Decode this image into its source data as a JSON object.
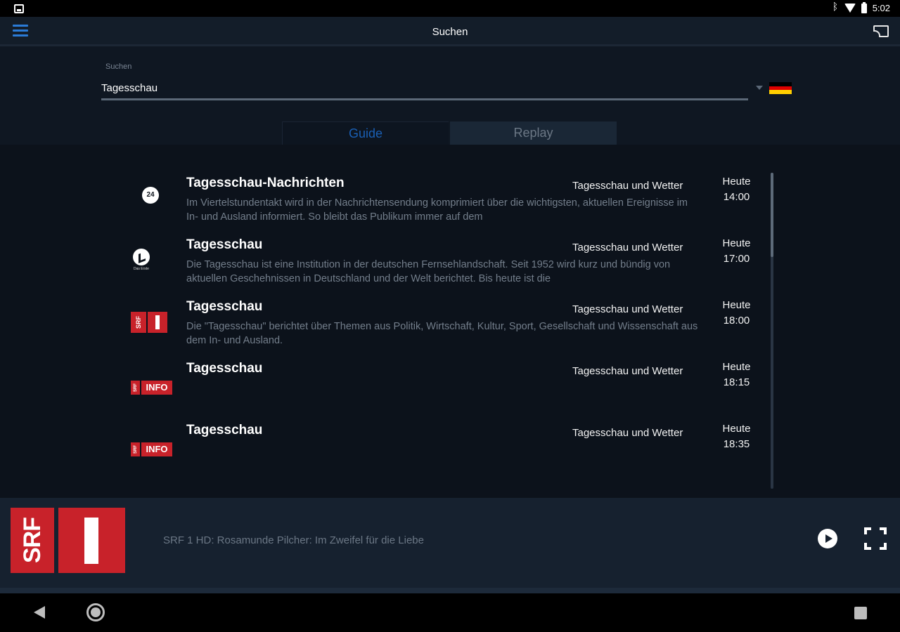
{
  "status_bar": {
    "time": "5:02"
  },
  "app_bar": {
    "title": "Suchen"
  },
  "search": {
    "label": "Suchen",
    "value": "Tagesschau",
    "country_flag": "germany-flag"
  },
  "tabs": [
    {
      "label": "Guide",
      "active": true
    },
    {
      "label": "Replay",
      "active": false
    }
  ],
  "results": [
    {
      "channel_logo": "tagesschau24-logo",
      "title": "Tagesschau-Nachrichten",
      "category": "Tagesschau und Wetter",
      "day": "Heute",
      "time": "14:00",
      "description": "Im Viertelstundentakt wird in der Nachrichtensendung komprimiert über die wichtigsten, aktuellen Ereignisse im In- und Ausland informiert. So bleibt das Publikum immer auf dem"
    },
    {
      "channel_logo": "das-erste-logo",
      "logo_text": "Das Erste",
      "title": "Tagesschau",
      "category": "Tagesschau und Wetter",
      "day": "Heute",
      "time": "17:00",
      "description": "Die Tagesschau ist eine Institution in der deutschen Fernsehlandschaft. Seit 1952 wird kurz und bündig von aktuellen Geschehnissen in Deutschland und der Welt berichtet. Bis heute ist die"
    },
    {
      "channel_logo": "srf1-logo",
      "logo_text": "SRF",
      "title": "Tagesschau",
      "category": "Tagesschau und Wetter",
      "day": "Heute",
      "time": "18:00",
      "description": "Die \"Tagesschau\" berichtet über Themen aus Politik, Wirtschaft, Kultur, Sport, Gesellschaft und Wissenschaft aus dem In- und Ausland."
    },
    {
      "channel_logo": "srf-info-logo",
      "logo_text": "SRF",
      "logo_text_2": "INFO",
      "title": "Tagesschau",
      "category": "Tagesschau und Wetter",
      "day": "Heute",
      "time": "18:15",
      "description": ""
    },
    {
      "channel_logo": "srf-info-logo",
      "logo_text": "SRF",
      "logo_text_2": "INFO",
      "title": "Tagesschau",
      "category": "Tagesschau und Wetter",
      "day": "Heute",
      "time": "18:35",
      "description": ""
    }
  ],
  "player": {
    "channel_logo": "srf1-logo",
    "logo_text": "SRF",
    "now_playing": "SRF 1 HD: Rosamunde Pilcher: Im Zweifel für die Liebe"
  },
  "colors": {
    "accent": "#2b7bd6",
    "active_tab_text": "#1a5fb4",
    "srf_red": "#c8222a",
    "background": "#0f1722"
  }
}
